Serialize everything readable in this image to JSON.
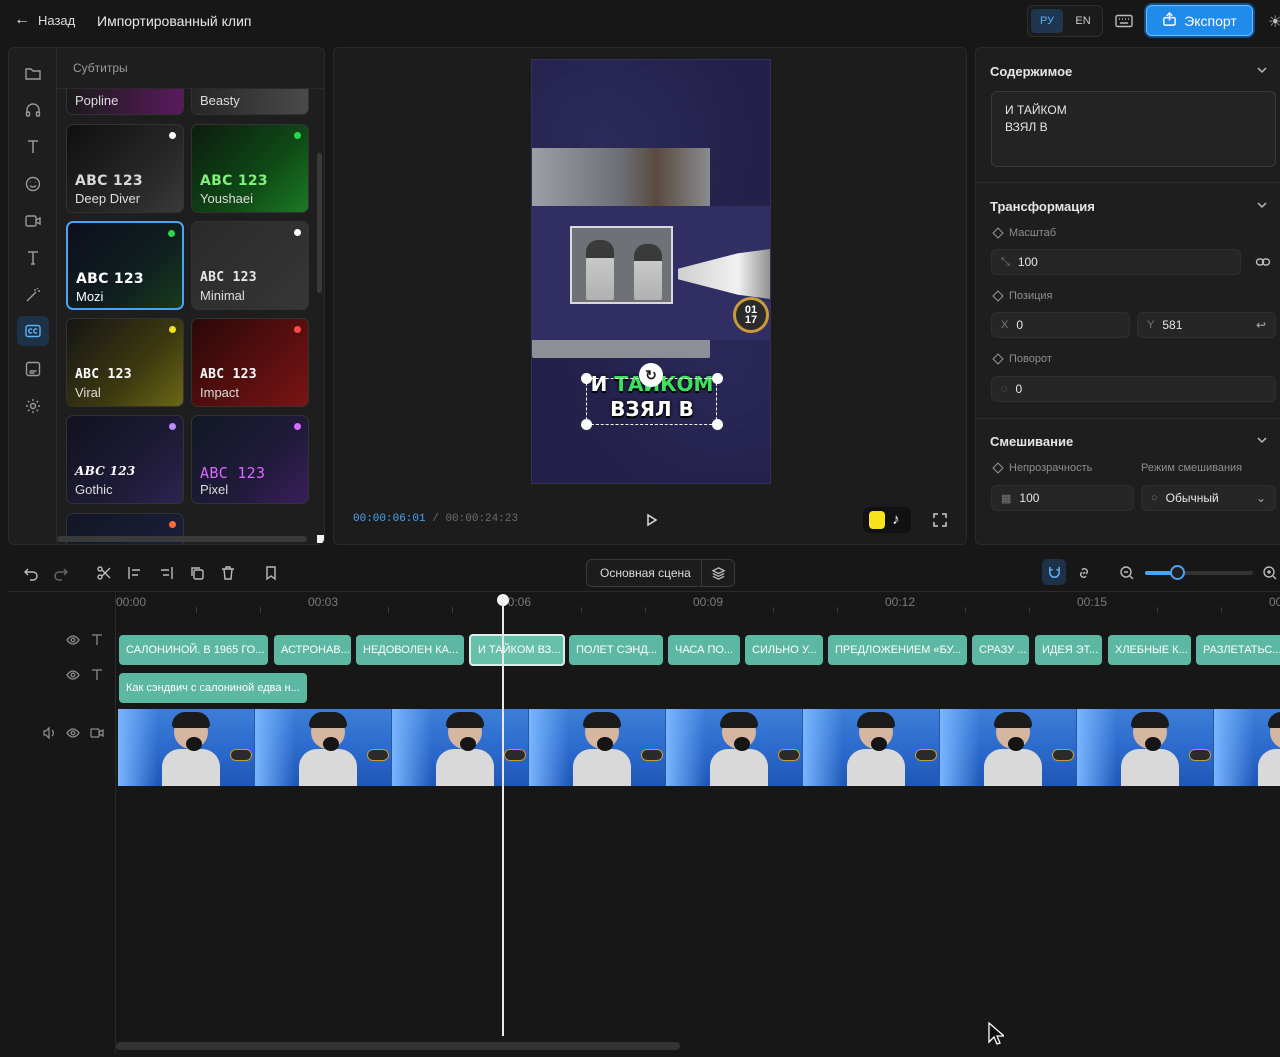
{
  "header": {
    "back_label": "Назад",
    "title": "Импортированный клип",
    "lang_ru": "РУ",
    "lang_en": "EN",
    "active_lang": "РУ",
    "export_label": "Экспорт",
    "accent": "#1f8bea"
  },
  "rail": {
    "icons": [
      "folder-icon",
      "headphones-icon",
      "text-icon",
      "emoji-icon",
      "camera-icon",
      "text-alt-icon",
      "magic-wand-icon",
      "captions-icon",
      "subtitle-template-icon",
      "settings-icon"
    ],
    "active": "captions-icon"
  },
  "styles_panel": {
    "title": "Субтитры",
    "styles": [
      {
        "name": "Popline",
        "sample": ""
      },
      {
        "name": "Beasty",
        "sample": ""
      },
      {
        "name": "Deep Diver",
        "sample": "ABC 123",
        "dot": "#ffffff"
      },
      {
        "name": "Youshaei",
        "sample": "ABC 123",
        "dot": "#27d94a"
      },
      {
        "name": "Mozi",
        "sample": "ABC 123",
        "dot": "#27d94a",
        "selected": true
      },
      {
        "name": "Minimal",
        "sample": "ABC 123",
        "dot": "#ffffff"
      },
      {
        "name": "Viral",
        "sample": "ABC 123",
        "dot": "#f2e21c"
      },
      {
        "name": "Impact",
        "sample": "ABC 123",
        "dot": "#ff4a4a"
      },
      {
        "name": "Gothic",
        "sample": "ABC 123",
        "dot": "#b58cff"
      },
      {
        "name": "Pixel",
        "sample": "ABC 123",
        "dot": "#d86bff"
      }
    ]
  },
  "preview": {
    "caption_line1_a": "И",
    "caption_line1_b": "ТАЙКОМ",
    "caption_line2": "ВЗЯЛ В",
    "badge_text": "01\n17",
    "current_time": "00:00:06:01",
    "separator": "/",
    "total_time": "00:00:24:23"
  },
  "properties": {
    "content_title": "Содержимое",
    "content_text": "И ТАЙКОМ\nВЗЯЛ В",
    "transform_title": "Трансформация",
    "scale_label": "Масштаб",
    "scale_value": "100",
    "position_label": "Позиция",
    "x_prefix": "X",
    "x_value": "0",
    "y_prefix": "Y",
    "y_value": "581",
    "rotation_label": "Поворот",
    "rotation_value": "0",
    "blend_title": "Смешивание",
    "opacity_label": "Непрозрачность",
    "opacity_value": "100",
    "blend_mode_label": "Режим смешивания",
    "blend_mode_value": "Обычный"
  },
  "timeline": {
    "scene_label": "Основная сцена",
    "zoom_level": 0.3,
    "ruler": [
      "00:00",
      "00:03",
      "00:06",
      "00:09",
      "00:12",
      "00:15",
      "00"
    ],
    "subtitle_clips": [
      {
        "text": "САЛОНИНОЙ. В 1965 ГО..."
      },
      {
        "text": "АСТРОНАВ..."
      },
      {
        "text": "НЕДОВОЛЕН КА..."
      },
      {
        "text": "И ТАЙКОМ ВЗ...",
        "selected": true
      },
      {
        "text": "ПОЛЕТ СЭНД..."
      },
      {
        "text": "ЧАСА ПО..."
      },
      {
        "text": "СИЛЬНО У..."
      },
      {
        "text": "ПРЕДЛОЖЕНИЕМ «БУ..."
      },
      {
        "text": "СРАЗУ ..."
      },
      {
        "text": "ИДЕЯ ЭТ..."
      },
      {
        "text": "ХЛЕБНЫЕ К..."
      },
      {
        "text": "РАЗЛЕТАТЬС..."
      }
    ],
    "text_clip": "Как сэндвич с салониной едва н...",
    "clip_color": "#5cb8a2"
  }
}
